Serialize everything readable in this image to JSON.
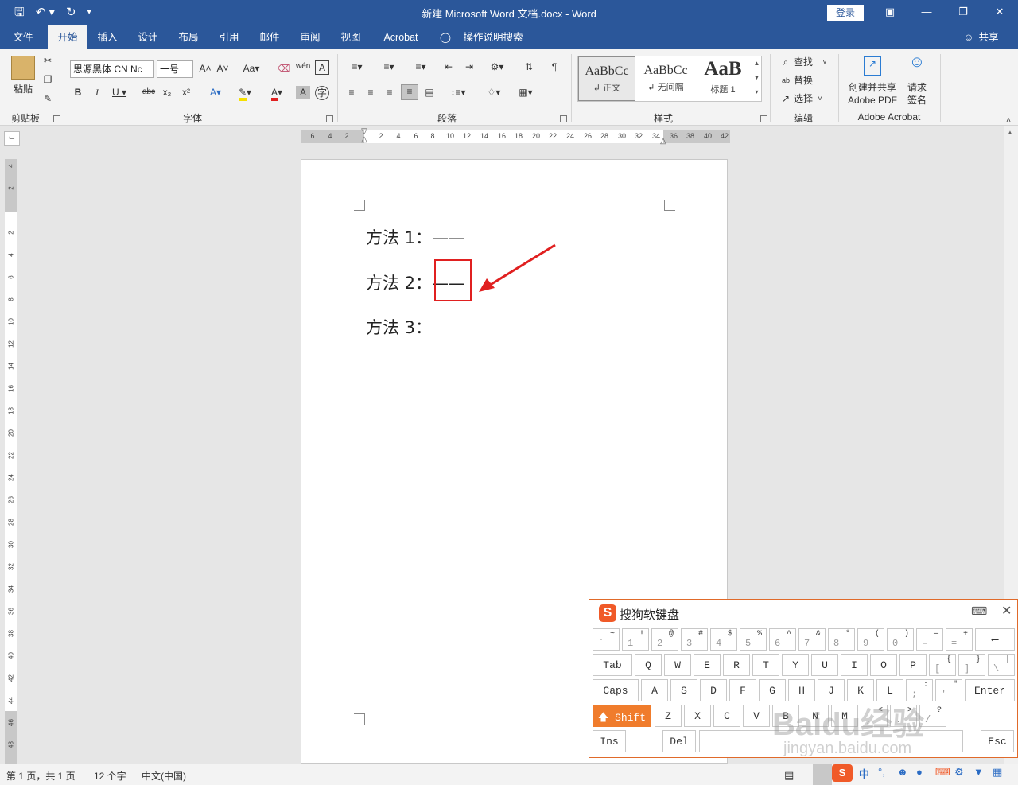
{
  "titlebar": {
    "title": "新建 Microsoft Word 文档.docx  -  Word",
    "login": "登录"
  },
  "menu": {
    "tabs": [
      "文件",
      "开始",
      "插入",
      "设计",
      "布局",
      "引用",
      "邮件",
      "审阅",
      "视图",
      "Acrobat"
    ],
    "tell_me": "操作说明搜索",
    "share": "共享"
  },
  "ribbon": {
    "clipboard": {
      "paste": "粘贴",
      "label": "剪贴板"
    },
    "font": {
      "name": "思源黑体 CN Nc",
      "size": "一号",
      "label": "字体"
    },
    "paragraph": {
      "label": "段落"
    },
    "styles": {
      "items": [
        {
          "preview": "AaBbCc",
          "name": "↲ 正文"
        },
        {
          "preview": "AaBbCc",
          "name": "↲ 无间隔"
        },
        {
          "preview": "AaB",
          "name": "标题 1"
        }
      ],
      "label": "样式"
    },
    "editing": {
      "find": "查找",
      "replace": "替换",
      "select": "选择",
      "label": "编辑"
    },
    "acrobat": {
      "create": "创建并共享",
      "create2": "Adobe PDF",
      "sign": "请求",
      "sign2": "签名",
      "label": "Adobe Acrobat"
    }
  },
  "ruler": {
    "h_ticks": [
      "6",
      "4",
      "2",
      "",
      "2",
      "4",
      "6",
      "8",
      "10",
      "12",
      "14",
      "16",
      "18",
      "20",
      "22",
      "24",
      "26",
      "28",
      "30",
      "32",
      "34",
      "36",
      "38",
      "40",
      "42"
    ],
    "v_ticks": [
      "4",
      "2",
      "",
      "2",
      "4",
      "6",
      "8",
      "10",
      "12",
      "14",
      "16",
      "18",
      "20",
      "22",
      "24",
      "26",
      "28",
      "30",
      "32",
      "34",
      "36",
      "38",
      "40",
      "42",
      "44",
      "46",
      "48"
    ]
  },
  "document": {
    "lines": [
      "方法 1：——",
      "方法 2：——",
      "方法 3："
    ]
  },
  "status": {
    "page": "第 1 页，共 1 页",
    "words": "12 个字",
    "lang": "中文(中国)"
  },
  "keyboard": {
    "title": "搜狗软键盘",
    "row1": [
      {
        "u": "~",
        "d": "`"
      },
      {
        "u": "!",
        "d": "1"
      },
      {
        "u": "@",
        "d": "2"
      },
      {
        "u": "#",
        "d": "3"
      },
      {
        "u": "$",
        "d": "4"
      },
      {
        "u": "%",
        "d": "5"
      },
      {
        "u": "^",
        "d": "6"
      },
      {
        "u": "&",
        "d": "7"
      },
      {
        "u": "*",
        "d": "8"
      },
      {
        "u": "(",
        "d": "9"
      },
      {
        "u": ")",
        "d": "0"
      },
      {
        "u": "—",
        "d": "–"
      },
      {
        "u": "+",
        "d": "="
      }
    ],
    "row2": [
      "Tab",
      "Q",
      "W",
      "E",
      "R",
      "T",
      "Y",
      "U",
      "I",
      "O",
      "P"
    ],
    "row3": [
      "Caps",
      "A",
      "S",
      "D",
      "F",
      "G",
      "H",
      "J",
      "K",
      "L"
    ],
    "row4": [
      "Shift",
      "Z",
      "X",
      "C",
      "V",
      "B",
      "N",
      "M"
    ],
    "row5": [
      "Ins",
      "Del",
      "Esc"
    ],
    "enter": "Enter",
    "backspace": "⟵"
  },
  "watermark": {
    "logo": "Baidu经验",
    "url": "jingyan.baidu.com"
  },
  "tray": {
    "ime": "中"
  }
}
